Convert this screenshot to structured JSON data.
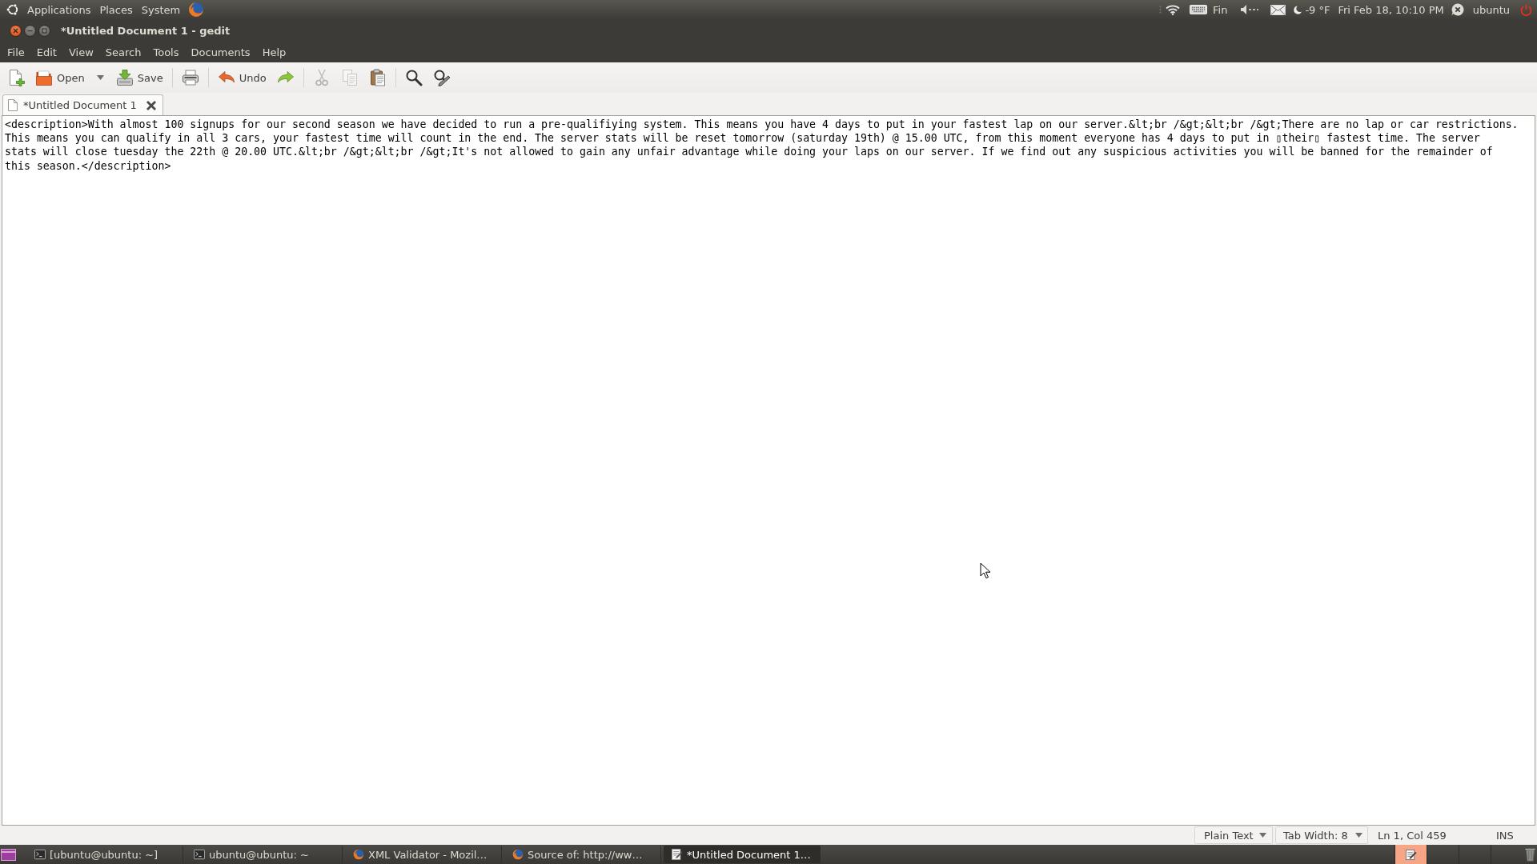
{
  "top_panel": {
    "menus": [
      "Applications",
      "Places",
      "System"
    ],
    "keyboard_layout": "Fin",
    "weather": "-9 °F",
    "clock": "Fri Feb 18, 10:10 PM",
    "user": "ubuntu"
  },
  "window": {
    "title": "*Untitled Document 1 - gedit"
  },
  "menu_bar": [
    "File",
    "Edit",
    "View",
    "Search",
    "Tools",
    "Documents",
    "Help"
  ],
  "toolbar": [
    {
      "kind": "new",
      "disabled": false
    },
    {
      "kind": "open",
      "label": "Open",
      "disabled": false
    },
    {
      "kind": "recent-menu",
      "disabled": false
    },
    {
      "kind": "save",
      "label": "Save",
      "disabled": false
    },
    {
      "kind": "separator"
    },
    {
      "kind": "print",
      "disabled": false
    },
    {
      "kind": "separator"
    },
    {
      "kind": "undo",
      "label": "Undo",
      "disabled": false
    },
    {
      "kind": "redo",
      "disabled": false
    },
    {
      "kind": "separator"
    },
    {
      "kind": "cut",
      "disabled": true
    },
    {
      "kind": "copy",
      "disabled": true
    },
    {
      "kind": "paste",
      "disabled": false
    },
    {
      "kind": "separator"
    },
    {
      "kind": "find",
      "disabled": false
    },
    {
      "kind": "replace",
      "disabled": false
    }
  ],
  "tabs": [
    {
      "label": "*Untitled Document 1",
      "selected": true
    }
  ],
  "editor": {
    "lines": [
      "<description>With almost 100 signups for our second season we have decided to run a pre-qualifiying system. This means you have 4 days to put in your fastest lap on our server.&lt;br /&gt;&lt;br /&gt;There are no lap or car restrictions.",
      "This means you can qualify in all 3 cars, your fastest time will count in the end. The server stats will be reset tomorrow (saturday 19th) @ 15.00 UTC, from this moment everyone has 4 days to put in ▯their▯ fastest time. The server",
      "stats will close tuesday the 22th @ 20.00 UTC.&lt;br /&gt;&lt;br /&gt;It's not allowed to gain any unfair advantage while doing your laps on our server. If we find out any suspicious activities you will be banned for the remainder of",
      "this season.</description>"
    ]
  },
  "status_bar": {
    "language": "Plain Text",
    "tab_width": "Tab Width: 8",
    "cursor_position": "Ln 1, Col 459",
    "insert_mode": "INS"
  },
  "taskbar": {
    "tasks": [
      {
        "kind": "terminal",
        "label": "[ubuntu@ubuntu: ~]",
        "selected": false
      },
      {
        "kind": "terminal",
        "label": "ubuntu@ubuntu: ~",
        "selected": false
      },
      {
        "kind": "browser",
        "label": "XML Validator - Mozil…",
        "selected": false
      },
      {
        "kind": "browser",
        "label": "Source of: http://ww…",
        "selected": false
      },
      {
        "kind": "editor",
        "label": "*Untitled Document 1…",
        "selected": true
      }
    ],
    "workspaces": [
      {
        "selected": true
      },
      {
        "selected": false
      },
      {
        "selected": false
      },
      {
        "selected": false
      }
    ]
  }
}
